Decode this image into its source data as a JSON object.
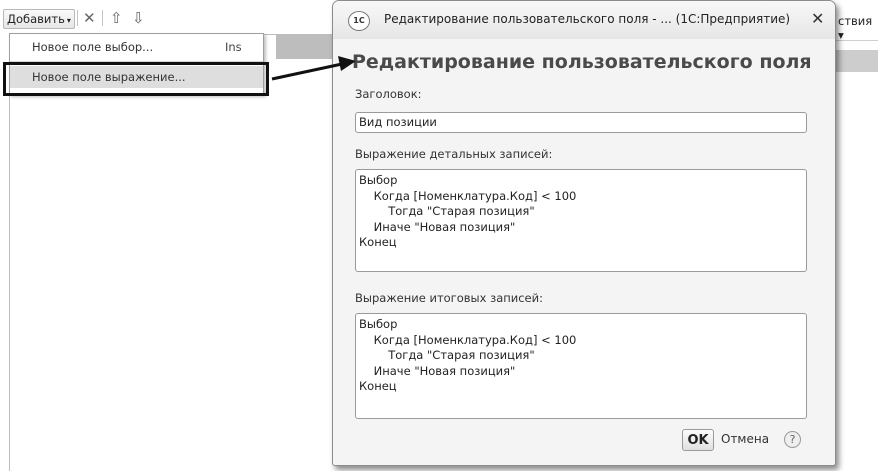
{
  "toolbar": {
    "add_label": "Добавить",
    "dropdown_caret": "▾",
    "delete_icon": "✕",
    "up_icon": "⇧",
    "down_icon": "⇩"
  },
  "menu": {
    "items": [
      {
        "label": "Новое поле выбор...",
        "shortcut": "Ins"
      },
      {
        "label": "Новое поле выражение...",
        "shortcut": ""
      }
    ]
  },
  "behind": {
    "actions_text": "ствия ▾"
  },
  "dialog": {
    "app_icon_text": "1C",
    "window_title": "Редактирование пользовательского поля - ... (1С:Предприятие)",
    "close_icon": "✕",
    "heading": "Редактирование пользовательского поля",
    "header_label": "Заголовок:",
    "header_value": "Вид позиции",
    "detail_label": "Выражение детальных записей:",
    "detail_lines": [
      "Выбор",
      "    Когда [Номенклатура.Код] < 100",
      "        Тогда \"Старая позиция\"",
      "    Иначе \"Новая позиция\"",
      "Конец"
    ],
    "total_label": "Выражение итоговых записей:",
    "total_lines": [
      "Выбор",
      "    Когда [Номенклатура.Код] < 100",
      "        Тогда \"Старая позиция\"",
      "    Иначе \"Новая позиция\"",
      "Конец"
    ],
    "ok_label": "OK",
    "cancel_label": "Отмена",
    "help_icon": "?"
  }
}
